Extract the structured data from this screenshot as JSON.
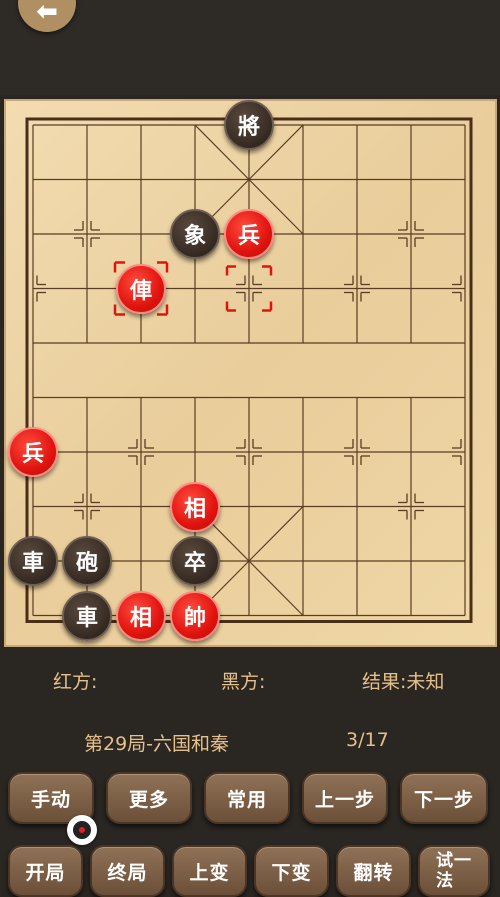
{
  "header": {
    "back_icon": "arrow-left-icon",
    "back_glyph": "⬅"
  },
  "board": {
    "files": 9,
    "ranks": 10,
    "pieces": [
      {
        "id": "black-general",
        "side": "black",
        "char": "將",
        "file": 4,
        "rank": 0
      },
      {
        "id": "black-elephant",
        "side": "black",
        "char": "象",
        "file": 3,
        "rank": 2
      },
      {
        "id": "red-soldier-top",
        "side": "red",
        "char": "兵",
        "file": 4,
        "rank": 2
      },
      {
        "id": "red-chariot-selected",
        "side": "red",
        "char": "俥",
        "file": 2,
        "rank": 3
      },
      {
        "id": "red-soldier-left",
        "side": "red",
        "char": "兵",
        "file": 0,
        "rank": 6
      },
      {
        "id": "red-minister-mid",
        "side": "red",
        "char": "相",
        "file": 3,
        "rank": 7
      },
      {
        "id": "black-chariot-left",
        "side": "black",
        "char": "車",
        "file": 0,
        "rank": 8
      },
      {
        "id": "black-cannon",
        "side": "black",
        "char": "砲",
        "file": 1,
        "rank": 8
      },
      {
        "id": "black-soldier",
        "side": "black",
        "char": "卒",
        "file": 3,
        "rank": 8
      },
      {
        "id": "black-chariot-bottom",
        "side": "black",
        "char": "車",
        "file": 1,
        "rank": 9
      },
      {
        "id": "red-minister-bottom",
        "side": "red",
        "char": "相",
        "file": 2,
        "rank": 9
      },
      {
        "id": "red-marshal",
        "side": "red",
        "char": "帥",
        "file": 3,
        "rank": 9
      }
    ],
    "selected": {
      "file": 2,
      "rank": 3
    },
    "move_target": {
      "file": 4,
      "rank": 3
    },
    "highlight_color": "#e0140f"
  },
  "info": {
    "red_label": "红方:",
    "black_label": "黑方:",
    "result_label": "结果:未知"
  },
  "game": {
    "title": "第29局-六国和秦",
    "progress": "3/17"
  },
  "buttons": {
    "row1": [
      "手动",
      "更多",
      "常用",
      "上一步",
      "下一步"
    ],
    "row2": [
      "开局",
      "终局",
      "上变",
      "下变",
      "翻转",
      "试一\n法"
    ]
  },
  "colors": {
    "background": "#2a2622",
    "label_gold": "#e6c08a",
    "button_brown": "#7a5c42",
    "red_piece": "#e0140f",
    "black_piece": "#3a2e26"
  }
}
